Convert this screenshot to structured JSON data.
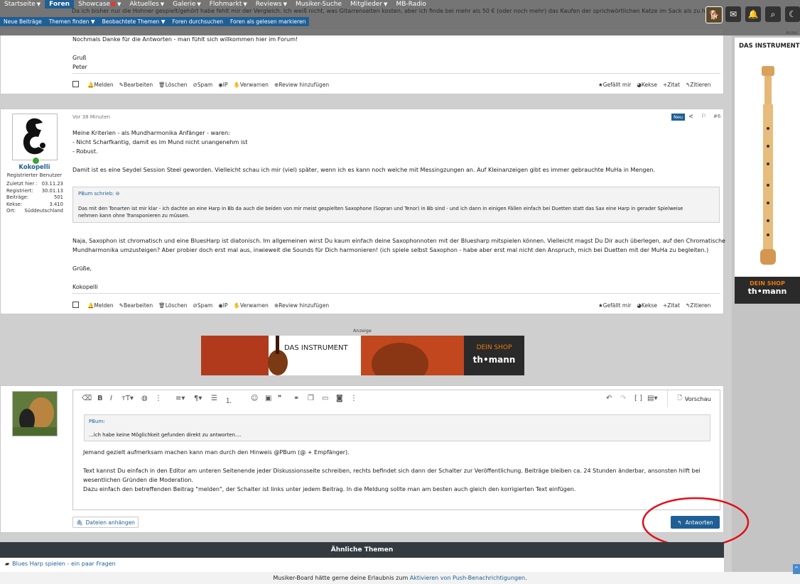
{
  "nav": {
    "items": [
      "Startseite",
      "Foren",
      "Showcase",
      "Aktuelles",
      "Galerie",
      "Flohmarkt",
      "Reviews",
      "Musiker-Suche",
      "Mitglieder",
      "MB-Radio"
    ],
    "active": "Foren",
    "sub_items": [
      "Neue Beiträge",
      "Themen finden",
      "Beobachtete Themen",
      "Foren durchsuchen",
      "Foren als gelesen markieren"
    ]
  },
  "ghost_text": "Da ich bisher nur die Hohner gespielt/gehört habe fehlt mir der Vergleich. Ich weiß nicht, was Gitarrenseiten kosten, aber ich finde bei mehr als 50 € (oder noch mehr) das Kaufen der sprichwörtlichen Katze im Sack als zu hohes",
  "post1": {
    "lines": [
      "Nochmals Danke für die Antworten - man fühlt sich willkommen hier im Forum!",
      "",
      "Gruß",
      "Peter"
    ]
  },
  "actions": {
    "left": [
      "Melden",
      "Bearbeiten",
      "Löschen",
      "Spam",
      "IP",
      "Verwarnen",
      "Review hinzufügen"
    ],
    "right": [
      "Gefällt mir",
      "Kekse",
      "+Zitat",
      "Zitieren"
    ]
  },
  "post2": {
    "time": "Vor 38 Minuten",
    "badge": "Neu",
    "number": "#6",
    "user": {
      "name": "Kokopelli",
      "title": "Registrierter Benutzer",
      "stats": [
        {
          "label": "Zuletzt hier :",
          "value": "03.11.23"
        },
        {
          "label": "Registriert:",
          "value": "30.01.13"
        },
        {
          "label": "Beiträge:",
          "value": "501"
        },
        {
          "label": "Kekse:",
          "value": "3.410"
        },
        {
          "label": "Ort:",
          "value": "Süddeutschland"
        }
      ]
    },
    "para1": [
      "Meine Kriterien - als Mundharmonika Anfänger - waren:",
      "- Nicht Scharfkantig, damit es im Mund nicht unangenehm ist",
      "- Robust."
    ],
    "para2": "Damit ist es eine Seydel Session Steel geworden. Vielleicht schau ich mir (viel) später, wenn ich es kann noch welche mit Messingzungen an. Auf Kleinanzeigen gibt es immer gebrauchte MuHa in Mengen.",
    "quote_author": "PBum schrieb:",
    "quote_text": [
      "Das mit den Tonarten ist mir klar - ich dachte an eine Harp in Bb da auch die beiden von mir meist gespielten Saxophone (Sopran und Tenor) in Bb sind - und ich dann in einigen Fällen einfach bei Duetten statt das Sax eine Harp in gerader Spielweise",
      "nehmen kann ohne Transponieren zu müssen."
    ],
    "para3": [
      "Naja, Saxophon ist chromatisch und eine BluesHarp ist diatonisch. Im allgemeinen wirst Du kaum einfach deine Saxophonnoten mit der Bluesharp mitspielen können. Vielleicht magst Du Dir auch überlegen, auf den Chromatische",
      "Mundharmonika umzusteigen? Aber probier doch erst mal aus, inwieweit die Sounds für Dich harmonieren! (ich spiele selbst Saxophon - habe aber erst mal nicht den Anspruch, mich bei Duetten mit der MuHa zu begleiten.)"
    ],
    "greeting": "Grüße,",
    "signature": "Kokopelli"
  },
  "ad": {
    "label": "Anzeige",
    "side_label": "Anzei",
    "instrument": "DAS INSTRUMENT",
    "shop": "DEIN SHOP",
    "brand": "th•mann"
  },
  "editor": {
    "preview": "Vorschau",
    "quote_author": "PBum:",
    "quote_text": "...ich habe keine Möglichkeit gefunden direkt zu antworten....",
    "lines": [
      "Jemand gezielt aufmerksam machen kann man durch den Hinweis @PBum (@ + Empfänger).",
      "",
      "Text kannst Du einfach in den Editor am unteren Seitenende jeder Diskussionsseite schreiben, rechts befindet sich dann der Schalter zur Veröffentlichung. Beiträge bleiben ca. 24 Stunden änderbar, ansonsten hilft bei",
      "wesentlichen Gründen die Moderation.",
      "Dazu einfach den betreffenden Beitrag \"melden\", der Schalter ist links unter jedem Beitrag. In die Meldung sollte man am besten auch gleich den korrigierten Text einfügen."
    ],
    "attach": "Dateien anhängen",
    "reply": "Antworten"
  },
  "similar": {
    "title": "Ähnliche Themen",
    "item": "Blues Harp spielen - ein paar Fragen"
  },
  "push_notice": {
    "prefix": "Musiker-Board hätte gerne deine Erlaubnis zum ",
    "link": "Aktivieren von Push-Benachrichtigungen",
    "suffix": "."
  },
  "colors": {
    "accent": "#1f5f95",
    "ad_orange": "#e87a10",
    "annotation_red": "#e0101a"
  }
}
